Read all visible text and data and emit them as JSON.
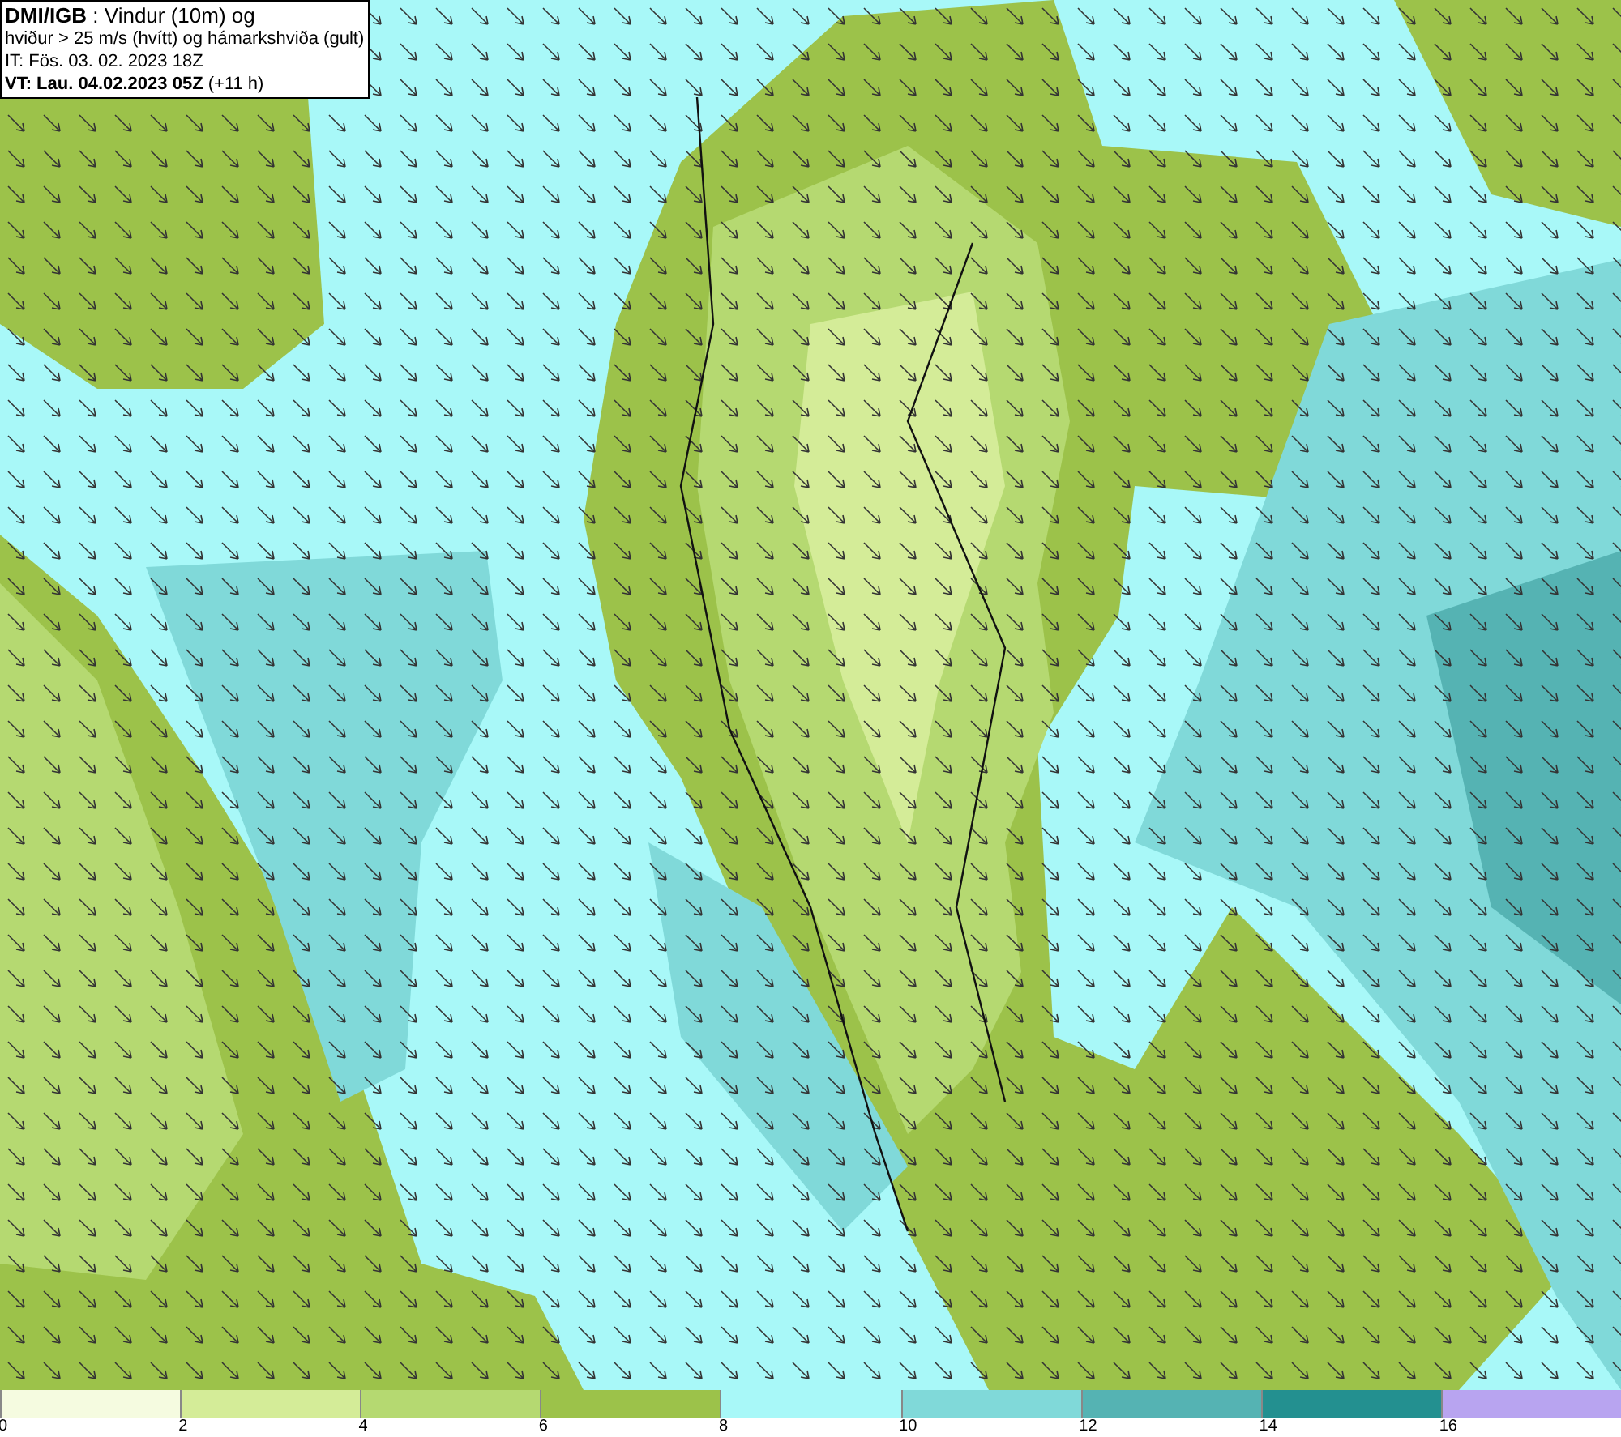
{
  "header": {
    "lines": [
      "**DMI/IGB** : Vindur (10m) og",
      "hviður > 25 m/s (hvítt) og hámarkshviða (gult)",
      "IT: Fös. 03. 02. 2023 18Z",
      "**VT: Lau. 04.02.2023 05Z** (+11 h)"
    ]
  },
  "legend": [
    {
      "label": "0",
      "color": "#f5fbe0"
    },
    {
      "label": "2",
      "color": "#d4ec98"
    },
    {
      "label": "4",
      "color": "#b5d971"
    },
    {
      "label": "6",
      "color": "#9cc24a"
    },
    {
      "label": "8",
      "color": "#a8f8f8"
    },
    {
      "label": "10",
      "color": "#80d9d9"
    },
    {
      "label": "12",
      "color": "#55b3b3"
    },
    {
      "label": "14",
      "color": "#239090"
    },
    {
      "label": "16",
      "color": "#b8a4f0"
    }
  ]
}
